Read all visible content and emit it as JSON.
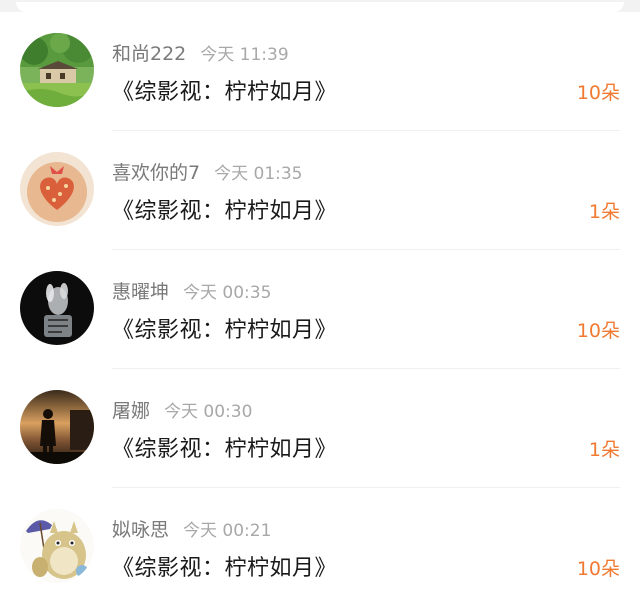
{
  "gifts": [
    {
      "user": "和尚222",
      "time": "今天 11:39",
      "title": "《综影视：柠柠如月》",
      "amount": "10朵",
      "avatar": "house-landscape-avatar"
    },
    {
      "user": "喜欢你的7",
      "time": "今天 01:35",
      "title": "《综影视：柠柠如月》",
      "amount": "1朵",
      "avatar": "heart-cookie-avatar"
    },
    {
      "user": "惠曜坤",
      "time": "今天 00:35",
      "title": "《综影视：柠柠如月》",
      "amount": "10朵",
      "avatar": "glass-figurine-avatar"
    },
    {
      "user": "屠娜",
      "time": "今天 00:30",
      "title": "《综影视：柠柠如月》",
      "amount": "1朵",
      "avatar": "sunset-silhouette-avatar"
    },
    {
      "user": "姒咏思",
      "time": "今天 00:21",
      "title": "《综影视：柠柠如月》",
      "amount": "10朵",
      "avatar": "totoro-avatar"
    }
  ],
  "colors": {
    "amount": "#f07a32",
    "username": "#7a7a7a",
    "time": "#a8a8a8",
    "title": "#1a1a1a"
  }
}
